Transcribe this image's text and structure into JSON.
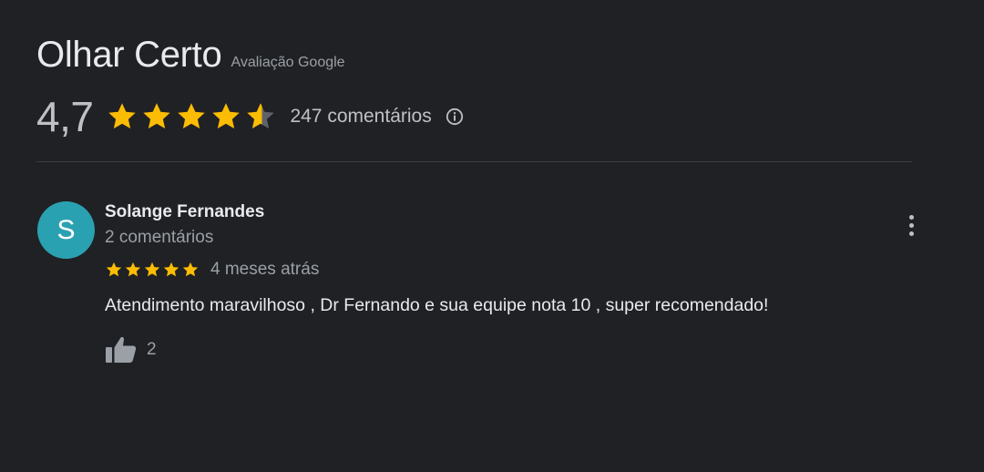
{
  "header": {
    "business_name": "Olhar Certo",
    "source_label": "Avaliação Google"
  },
  "summary": {
    "rating_value": "4,7",
    "rating": 4.7,
    "max_rating": 5,
    "review_count_text": "247 comentários",
    "info_icon": "info-circle-icon"
  },
  "review": {
    "avatar_initial": "S",
    "avatar_color": "#2aa1b1",
    "author_name": "Solange Fernandes",
    "author_meta": "2 comentários",
    "stars": 5,
    "time_ago": "4 meses atrás",
    "text": "Atendimento maravilhoso , Dr Fernando e sua equipe nota 10 , super recomendado!",
    "like_icon": "thumbs-up-icon",
    "like_count": "2",
    "menu_icon": "more-vert-icon"
  },
  "colors": {
    "background": "#202124",
    "star_filled": "#fbbc04",
    "star_empty": "#5f6368",
    "avatar": "#2aa1b1"
  }
}
